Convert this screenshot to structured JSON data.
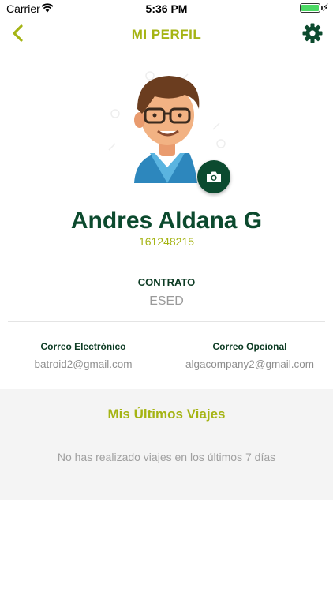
{
  "status": {
    "carrier": "Carrier",
    "time": "5:36 PM",
    "battery_color": "#4cd964"
  },
  "nav": {
    "title": "MI PERFIL",
    "back_icon": "chevron-left-icon",
    "settings_icon": "gear-icon"
  },
  "profile": {
    "name": "Andres Aldana G",
    "id": "161248215",
    "camera_icon": "camera-icon"
  },
  "contract": {
    "label": "CONTRATO",
    "value": "ESED"
  },
  "emails": {
    "primary_label": "Correo Electrónico",
    "primary_value": "batroid2@gmail.com",
    "optional_label": "Correo Opcional",
    "optional_value": "algacompany2@gmail.com"
  },
  "trips": {
    "title": "Mis Últimos Viajes",
    "empty_message": "No has realizado viajes en los últimos 7 días"
  },
  "colors": {
    "accent": "#a5b414",
    "dark_green": "#0c4a2e"
  }
}
